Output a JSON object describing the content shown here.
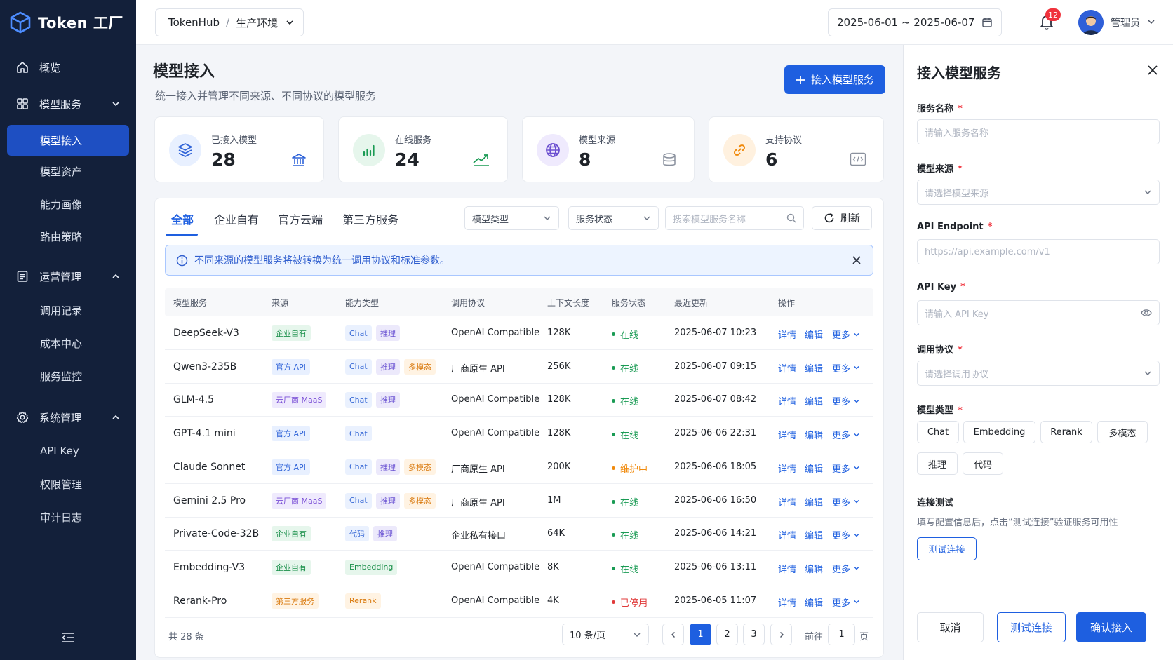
{
  "app": {
    "name": "Token 工厂"
  },
  "sidebar": {
    "items": [
      {
        "label": "概览"
      },
      {
        "label": "模型服务",
        "children": [
          "模型接入",
          "模型资产",
          "能力画像",
          "路由策略"
        ]
      },
      {
        "label": "运营管理",
        "children": [
          "调用记录",
          "成本中心",
          "服务监控"
        ]
      },
      {
        "label": "系统管理",
        "children": [
          "API Key",
          "权限管理",
          "审计日志"
        ]
      }
    ]
  },
  "header": {
    "breadcrumb": {
      "root": "TokenHub",
      "separator": "/",
      "current": "生产环境"
    },
    "date_range": "2025-06-01 ~ 2025-06-07",
    "notifications": "12",
    "user": "管理员"
  },
  "page": {
    "title": "模型接入",
    "subtitle": "统一接入并管理不同来源、不同协议的模型服务",
    "primary_action": "接入模型服务"
  },
  "stats": [
    {
      "label": "已接入模型",
      "value": "28"
    },
    {
      "label": "在线服务",
      "value": "24"
    },
    {
      "label": "模型来源",
      "value": "8"
    },
    {
      "label": "支持协议",
      "value": "6"
    }
  ],
  "tabs": [
    "全部",
    "企业自有",
    "官方云端",
    "第三方服务"
  ],
  "filters": {
    "model_type": "模型类型",
    "service_status": "服务状态",
    "search_placeholder": "搜索模型服务名称",
    "refresh": "刷新"
  },
  "alert": "不同来源的模型服务将被转换为统一调用协议和标准参数。",
  "table": {
    "columns": [
      "模型服务",
      "来源",
      "能力类型",
      "调用协议",
      "上下文长度",
      "服务状态",
      "最近更新",
      "操作"
    ],
    "actions": [
      "详情",
      "编辑",
      "更多"
    ],
    "rows": [
      {
        "name": "DeepSeek-V3",
        "source": "企业自有",
        "caps": [
          "Chat",
          "推理"
        ],
        "protocol": "OpenAI Compatible",
        "context": "128K",
        "status": "在线",
        "updated": "2025-06-07 10:23"
      },
      {
        "name": "Qwen3-235B",
        "source": "官方 API",
        "caps": [
          "Chat",
          "推理",
          "多模态"
        ],
        "protocol": "厂商原生 API",
        "context": "256K",
        "status": "在线",
        "updated": "2025-06-07 09:15"
      },
      {
        "name": "GLM-4.5",
        "source": "云厂商 MaaS",
        "caps": [
          "Chat",
          "推理"
        ],
        "protocol": "OpenAI Compatible",
        "context": "128K",
        "status": "在线",
        "updated": "2025-06-07 08:42"
      },
      {
        "name": "GPT-4.1 mini",
        "source": "官方 API",
        "caps": [
          "Chat"
        ],
        "protocol": "OpenAI Compatible",
        "context": "128K",
        "status": "在线",
        "updated": "2025-06-06 22:31"
      },
      {
        "name": "Claude Sonnet",
        "source": "官方 API",
        "caps": [
          "Chat",
          "推理",
          "多模态"
        ],
        "protocol": "厂商原生 API",
        "context": "200K",
        "status": "维护中",
        "updated": "2025-06-06 18:05"
      },
      {
        "name": "Gemini 2.5 Pro",
        "source": "云厂商 MaaS",
        "caps": [
          "Chat",
          "推理",
          "多模态"
        ],
        "protocol": "厂商原生 API",
        "context": "1M",
        "status": "在线",
        "updated": "2025-06-06 16:50"
      },
      {
        "name": "Private-Code-32B",
        "source": "企业自有",
        "caps": [
          "代码",
          "推理"
        ],
        "protocol": "企业私有接口",
        "context": "64K",
        "status": "在线",
        "updated": "2025-06-06 14:21"
      },
      {
        "name": "Embedding-V3",
        "source": "企业自有",
        "caps": [
          "Embedding"
        ],
        "protocol": "OpenAI Compatible",
        "context": "8K",
        "status": "在线",
        "updated": "2025-06-06 13:11"
      },
      {
        "name": "Rerank-Pro",
        "source": "第三方服务",
        "caps": [
          "Rerank"
        ],
        "protocol": "OpenAI Compatible",
        "context": "4K",
        "status": "已停用",
        "updated": "2025-06-05 11:07"
      }
    ]
  },
  "pagination": {
    "total": "共 28 条",
    "page_size": "10 条/页",
    "pages": [
      "1",
      "2",
      "3"
    ],
    "goto_label": "前往",
    "goto_value": "1",
    "goto_suffix": "页"
  },
  "drawer": {
    "title": "接入模型服务",
    "fields": {
      "service_name": {
        "label": "服务名称",
        "placeholder": "请输入服务名称"
      },
      "model_source": {
        "label": "模型来源",
        "placeholder": "请选择模型来源"
      },
      "endpoint": {
        "label": "API Endpoint",
        "placeholder": "https://api.example.com/v1"
      },
      "api_key": {
        "label": "API Key",
        "placeholder": "请输入 API Key"
      },
      "protocol": {
        "label": "调用协议",
        "placeholder": "请选择调用协议"
      },
      "model_type": {
        "label": "模型类型",
        "options": [
          "Chat",
          "Embedding",
          "Rerank",
          "多模态",
          "推理",
          "代码"
        ]
      }
    },
    "required_mark": "*",
    "connection": {
      "label": "连接测试",
      "hint": "填写配置信息后，点击“测试连接”验证服务可用性",
      "button": "测试连接"
    },
    "footer": {
      "cancel": "取消",
      "test": "测试连接",
      "confirm": "确认接入"
    }
  },
  "colors": {
    "primary": "#1e5fe0",
    "sidebar": "#13203a",
    "online": "#1a9b54",
    "maintenance": "#f08a0c",
    "disabled": "#e03a3a"
  }
}
